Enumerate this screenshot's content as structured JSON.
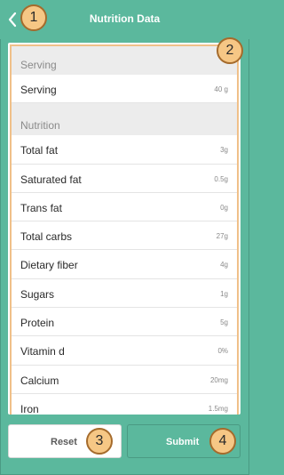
{
  "header": {
    "title": "Nutrition Data"
  },
  "annotations": [
    "1",
    "2",
    "3",
    "4"
  ],
  "serving_section": {
    "header": "Serving",
    "rows": [
      {
        "label": "Serving",
        "value": "40 g"
      }
    ]
  },
  "nutrition_section": {
    "header": "Nutrition",
    "rows": [
      {
        "label": "Total fat",
        "value": "3g"
      },
      {
        "label": "Saturated fat",
        "value": "0.5g"
      },
      {
        "label": "Trans fat",
        "value": "0g"
      },
      {
        "label": "Total carbs",
        "value": "27g"
      },
      {
        "label": "Dietary fiber",
        "value": "4g"
      },
      {
        "label": "Sugars",
        "value": "1g"
      },
      {
        "label": "Protein",
        "value": "5g"
      },
      {
        "label": "Vitamin d",
        "value": "0%"
      },
      {
        "label": "Calcium",
        "value": "20mg"
      },
      {
        "label": "Iron",
        "value": "1.5mg"
      }
    ]
  },
  "buttons": {
    "reset": "Reset",
    "submit": "Submit"
  },
  "colors": {
    "accent": "#5bb89d",
    "annotation_fill": "#f6c785",
    "annotation_border": "#a56b2c",
    "panel_highlight": "#f0c089"
  },
  "icons": {
    "back": "chevron-left-icon"
  }
}
